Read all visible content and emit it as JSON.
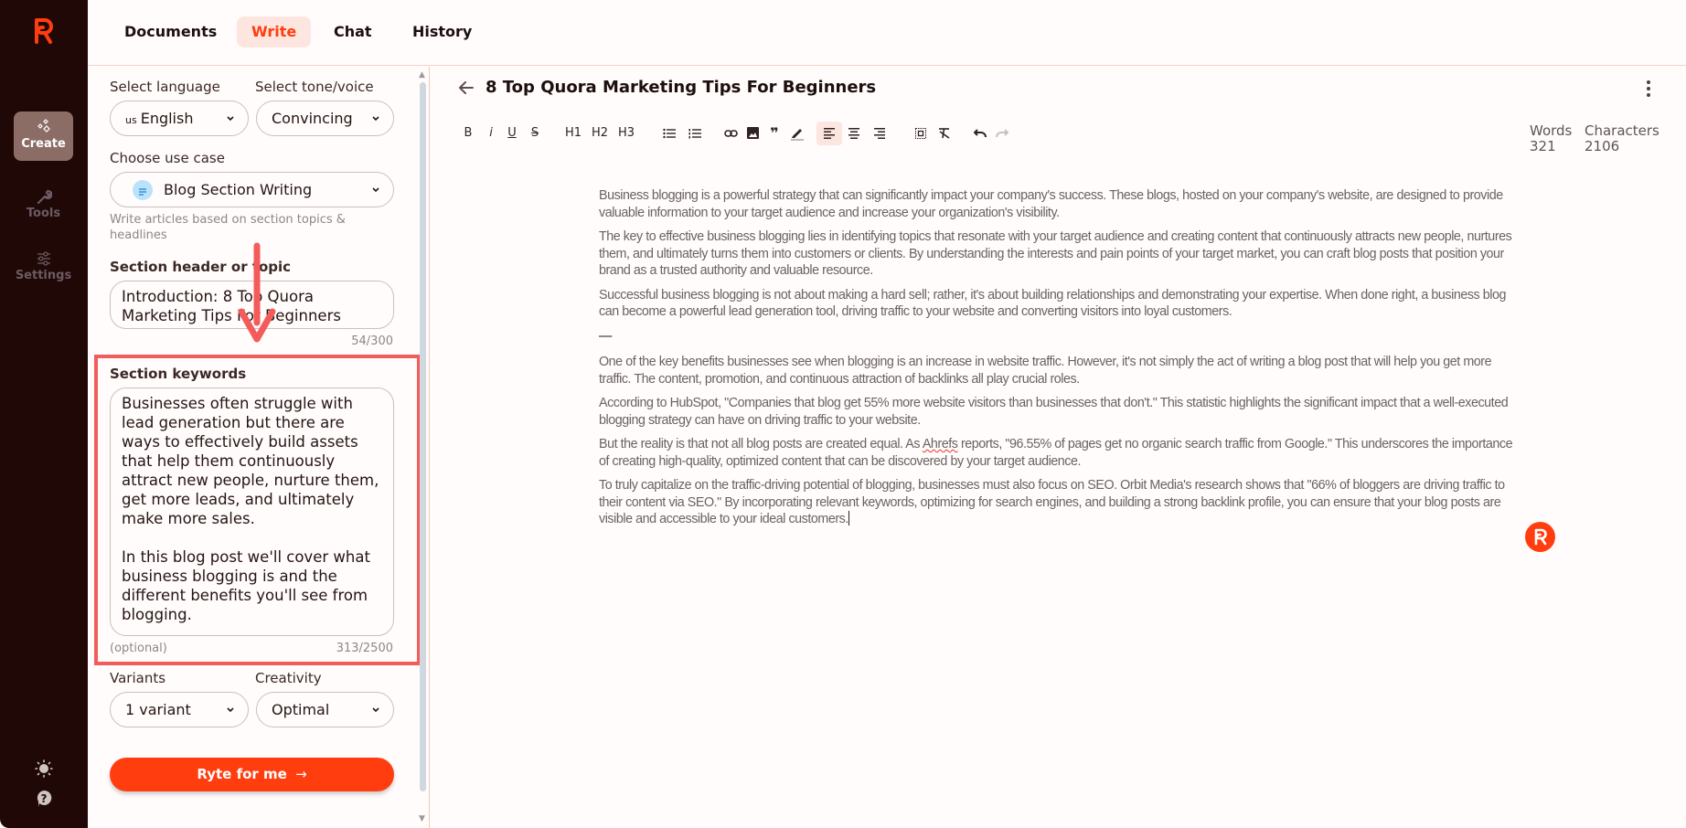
{
  "app": {
    "brand_color": "#ff3d0f",
    "sidebar_bg": "#200806"
  },
  "sidebar": {
    "items": [
      {
        "label": "Create",
        "icon": "sparkles-icon",
        "active": true
      },
      {
        "label": "Tools",
        "icon": "wrench-icon",
        "active": false
      },
      {
        "label": "Settings",
        "icon": "sliders-icon",
        "active": false
      }
    ],
    "bottom": [
      {
        "icon": "sun-icon"
      },
      {
        "icon": "help-icon"
      }
    ]
  },
  "topnav": {
    "tabs": [
      {
        "label": "Documents",
        "active": false
      },
      {
        "label": "Write",
        "active": true
      },
      {
        "label": "Chat",
        "active": false
      },
      {
        "label": "History",
        "active": false
      }
    ]
  },
  "form": {
    "language": {
      "label": "Select language",
      "flag": "us",
      "value": "English"
    },
    "tone": {
      "label": "Select tone/voice",
      "value": "Convincing"
    },
    "use_case": {
      "label": "Choose use case",
      "value": "Blog Section Writing",
      "hint": "Write articles based on section topics & headlines"
    },
    "section_header": {
      "label": "Section header or topic",
      "value": "Introduction: 8 Top Quora Marketing Tips For Beginners",
      "count": "54/300"
    },
    "section_keywords": {
      "label": "Section keywords",
      "value": "Businesses often struggle with lead generation but there are ways to effectively build assets that help them continuously attract new people, nurture them, get more leads, and ultimately make more sales.\n\nIn this blog post we'll cover what business blogging is and the different benefits you'll see from blogging.",
      "optional": "(optional)",
      "count": "313/2500"
    },
    "variants": {
      "label": "Variants",
      "value": "1 variant"
    },
    "creativity": {
      "label": "Creativity",
      "value": "Optimal"
    },
    "submit_label": "Ryte for me",
    "submit_arrow": "→"
  },
  "editor": {
    "title": "8 Top Quora Marketing Tips For Beginners",
    "stats": {
      "words_label": "Words",
      "words": "321",
      "chars_label": "Characters",
      "chars": "2106"
    },
    "toolbar": {
      "bold": "B",
      "italic": "i",
      "underline": "U",
      "strike": "S",
      "h1": "H1",
      "h2": "H2",
      "h3": "H3"
    },
    "separator": "—",
    "paragraphs_top": [
      "Business blogging is a powerful strategy that can significantly impact your company's success. These blogs, hosted on your company's website, are designed to provide valuable information to your target audience and increase your organization's visibility.",
      "The key to effective business blogging lies in identifying topics that resonate with your target audience and creating content that continuously attracts new people, nurtures them, and ultimately turns them into customers or clients. By understanding the interests and pain points of your target market, you can craft blog posts that position your brand as a trusted authority and valuable resource.",
      "Successful business blogging is not about making a hard sell; rather, it's about building relationships and demonstrating your expertise. When done right, a business blog can become a powerful lead generation tool, driving traffic to your website and converting visitors into loyal customers."
    ],
    "paragraphs_bottom": [
      "One of the key benefits businesses see when blogging is an increase in website traffic. However, it's not simply the act of writing a blog post that will help you get more traffic. The content, promotion, and continuous attraction of backlinks all play crucial roles.",
      "According to HubSpot, \"Companies that blog get 55% more website visitors than businesses that don't.\" This statistic highlights the significant impact that a well-executed blogging strategy can have on driving traffic to your website."
    ],
    "p_ahrefs": {
      "before": "But the reality is that not all blog posts are created equal. As ",
      "misspelled": "Ahrefs",
      "after": " reports, \"96.55% of pages get no organic search traffic from Google.\" This underscores the importance of creating high-quality, optimized content that can be discovered by your target audience."
    },
    "p_last": "To truly capitalize on the traffic-driving potential of blogging, businesses must also focus on SEO. Orbit Media's research shows that \"66% of bloggers are driving traffic to their content via SEO.\" By incorporating relevant keywords, optimizing for search engines, and building a strong backlink profile, you can ensure that your blog posts are visible and accessible to your ideal customers."
  }
}
